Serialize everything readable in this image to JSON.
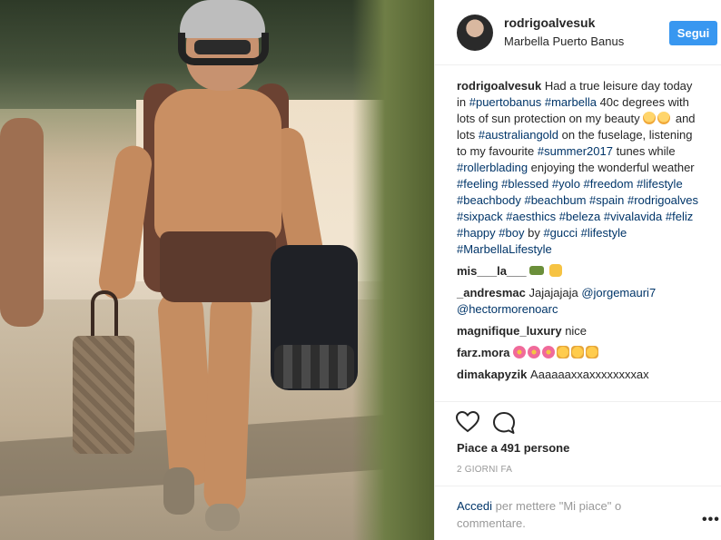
{
  "post": {
    "username": "rodrigoalvesuk",
    "location": "Marbella Puerto Banus",
    "follow_label": "Segui"
  },
  "caption": {
    "username": "rodrigoalvesuk",
    "t1": " Had a true leisure day today in ",
    "h1": "#puertobanus",
    "t2": " ",
    "h2": "#marbella",
    "t3": " 40c degrees with lots of sun protection on my beauty ",
    "t4": " and lots ",
    "h3": "#australiangold",
    "t5": " on the fuselage, listening to my favourite ",
    "h4": "#summer2017",
    "t6": " tunes while ",
    "h5": "#rollerblading",
    "t7": " enjoying the wonderful weather ",
    "h6": "#feeling",
    "h7": "#blessed",
    "h8": "#yolo",
    "h9": "#freedom",
    "h10": "#lifestyle",
    "h11": "#beachbody",
    "h12": "#beachbum",
    "h13": "#spain",
    "h14": "#rodrigoalves",
    "h15": "#sixpack",
    "h16": "#aesthics",
    "h17": "#beleza",
    "h18": "#vivalavida",
    "h19": "#feliz",
    "h20": "#happy",
    "h21": "#boy",
    "t8": " by ",
    "h22": "#gucci",
    "h23": "#lifestyle",
    "h24": "#MarbellaLifestyle"
  },
  "comments": [
    {
      "username": "mis___la___",
      "text": ""
    },
    {
      "username": "_andresmac",
      "text": " Jajajajaja ",
      "mention1": "@jorgemauri7",
      "mention2": "@hectormorenoarc"
    },
    {
      "username": "magnifique_luxury",
      "text": " nice"
    },
    {
      "username": "farz.mora",
      "text": ""
    },
    {
      "username": "dimakapyzik",
      "text": " Ааааааххаххххххххаx"
    }
  ],
  "likes": "Piace a 491 persone",
  "timestamp": "2 GIORNI FA",
  "add_comment": {
    "login_label": "Accedi",
    "rest": " per mettere \"Mi piace\" o commentare."
  },
  "icons": {
    "heart": "heart-icon",
    "comment": "comment-icon",
    "more": "more-options-icon"
  },
  "colors": {
    "follow_button": "#3897f0",
    "hashtag": "#003569",
    "muted": "#999999"
  }
}
